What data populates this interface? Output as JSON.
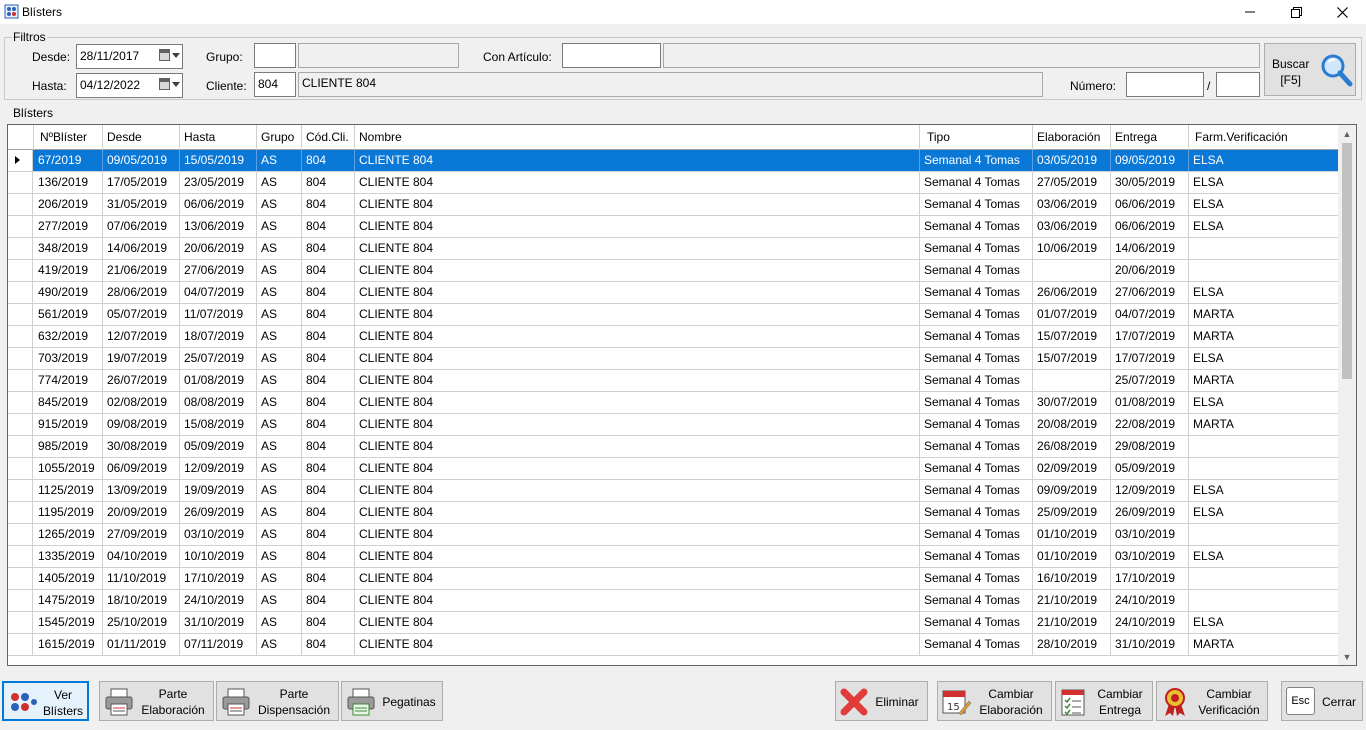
{
  "window": {
    "title": "Blísters"
  },
  "filters": {
    "group_label": "Filtros",
    "desde_label": "Desde:",
    "desde_value": "28/11/2017",
    "hasta_label": "Hasta:",
    "hasta_value": "04/12/2022",
    "grupo_label": "Grupo:",
    "grupo_code": "",
    "grupo_name": "",
    "cliente_label": "Cliente:",
    "cliente_code": "804",
    "cliente_name": "CLIENTE 804",
    "articulo_label": "Con Artículo:",
    "articulo_code": "",
    "articulo_name": "",
    "numero_label": "Número:",
    "numero_value": "",
    "numero_sep": "/",
    "numero_value2": "",
    "buscar_label_1": "Buscar",
    "buscar_label_2": "[F5]"
  },
  "grid": {
    "group_label": "Blísters",
    "columns": [
      "NºBlíster",
      "Desde",
      "Hasta",
      "Grupo",
      "Cód.Cli.",
      "Nombre",
      "Tipo",
      "Elaboración",
      "Entrega",
      "Farm.Verificación"
    ],
    "rows": [
      [
        "67/2019",
        "09/05/2019",
        "15/05/2019",
        "AS",
        "804",
        "CLIENTE 804",
        "Semanal 4 Tomas",
        "03/05/2019",
        "09/05/2019",
        "ELSA"
      ],
      [
        "136/2019",
        "17/05/2019",
        "23/05/2019",
        "AS",
        "804",
        "CLIENTE 804",
        "Semanal 4 Tomas",
        "27/05/2019",
        "30/05/2019",
        "ELSA"
      ],
      [
        "206/2019",
        "31/05/2019",
        "06/06/2019",
        "AS",
        "804",
        "CLIENTE 804",
        "Semanal 4 Tomas",
        "03/06/2019",
        "06/06/2019",
        "ELSA"
      ],
      [
        "277/2019",
        "07/06/2019",
        "13/06/2019",
        "AS",
        "804",
        "CLIENTE 804",
        "Semanal 4 Tomas",
        "03/06/2019",
        "06/06/2019",
        "ELSA"
      ],
      [
        "348/2019",
        "14/06/2019",
        "20/06/2019",
        "AS",
        "804",
        "CLIENTE 804",
        "Semanal 4 Tomas",
        "10/06/2019",
        "14/06/2019",
        ""
      ],
      [
        "419/2019",
        "21/06/2019",
        "27/06/2019",
        "AS",
        "804",
        "CLIENTE 804",
        "Semanal 4 Tomas",
        "",
        "20/06/2019",
        ""
      ],
      [
        "490/2019",
        "28/06/2019",
        "04/07/2019",
        "AS",
        "804",
        "CLIENTE 804",
        "Semanal 4 Tomas",
        "26/06/2019",
        "27/06/2019",
        "ELSA"
      ],
      [
        "561/2019",
        "05/07/2019",
        "11/07/2019",
        "AS",
        "804",
        "CLIENTE 804",
        "Semanal 4 Tomas",
        "01/07/2019",
        "04/07/2019",
        "MARTA"
      ],
      [
        "632/2019",
        "12/07/2019",
        "18/07/2019",
        "AS",
        "804",
        "CLIENTE 804",
        "Semanal 4 Tomas",
        "15/07/2019",
        "17/07/2019",
        "MARTA"
      ],
      [
        "703/2019",
        "19/07/2019",
        "25/07/2019",
        "AS",
        "804",
        "CLIENTE 804",
        "Semanal 4 Tomas",
        "15/07/2019",
        "17/07/2019",
        "ELSA"
      ],
      [
        "774/2019",
        "26/07/2019",
        "01/08/2019",
        "AS",
        "804",
        "CLIENTE 804",
        "Semanal 4 Tomas",
        "",
        "25/07/2019",
        "MARTA"
      ],
      [
        "845/2019",
        "02/08/2019",
        "08/08/2019",
        "AS",
        "804",
        "CLIENTE 804",
        "Semanal 4 Tomas",
        "30/07/2019",
        "01/08/2019",
        "ELSA"
      ],
      [
        "915/2019",
        "09/08/2019",
        "15/08/2019",
        "AS",
        "804",
        "CLIENTE 804",
        "Semanal 4 Tomas",
        "20/08/2019",
        "22/08/2019",
        "MARTA"
      ],
      [
        "985/2019",
        "30/08/2019",
        "05/09/2019",
        "AS",
        "804",
        "CLIENTE 804",
        "Semanal 4 Tomas",
        "26/08/2019",
        "29/08/2019",
        ""
      ],
      [
        "1055/2019",
        "06/09/2019",
        "12/09/2019",
        "AS",
        "804",
        "CLIENTE 804",
        "Semanal 4 Tomas",
        "02/09/2019",
        "05/09/2019",
        ""
      ],
      [
        "1125/2019",
        "13/09/2019",
        "19/09/2019",
        "AS",
        "804",
        "CLIENTE 804",
        "Semanal 4 Tomas",
        "09/09/2019",
        "12/09/2019",
        "ELSA"
      ],
      [
        "1195/2019",
        "20/09/2019",
        "26/09/2019",
        "AS",
        "804",
        "CLIENTE 804",
        "Semanal 4 Tomas",
        "25/09/2019",
        "26/09/2019",
        "ELSA"
      ],
      [
        "1265/2019",
        "27/09/2019",
        "03/10/2019",
        "AS",
        "804",
        "CLIENTE 804",
        "Semanal 4 Tomas",
        "01/10/2019",
        "03/10/2019",
        ""
      ],
      [
        "1335/2019",
        "04/10/2019",
        "10/10/2019",
        "AS",
        "804",
        "CLIENTE 804",
        "Semanal 4 Tomas",
        "01/10/2019",
        "03/10/2019",
        "ELSA"
      ],
      [
        "1405/2019",
        "11/10/2019",
        "17/10/2019",
        "AS",
        "804",
        "CLIENTE 804",
        "Semanal 4 Tomas",
        "16/10/2019",
        "17/10/2019",
        ""
      ],
      [
        "1475/2019",
        "18/10/2019",
        "24/10/2019",
        "AS",
        "804",
        "CLIENTE 804",
        "Semanal 4 Tomas",
        "21/10/2019",
        "24/10/2019",
        ""
      ],
      [
        "1545/2019",
        "25/10/2019",
        "31/10/2019",
        "AS",
        "804",
        "CLIENTE 804",
        "Semanal 4 Tomas",
        "21/10/2019",
        "24/10/2019",
        "ELSA"
      ],
      [
        "1615/2019",
        "01/11/2019",
        "07/11/2019",
        "AS",
        "804",
        "CLIENTE 804",
        "Semanal 4 Tomas",
        "28/10/2019",
        "31/10/2019",
        "MARTA"
      ]
    ],
    "selected_row": 0
  },
  "buttons": {
    "ver_blisters": [
      "Ver",
      "Blísters"
    ],
    "parte_elaboracion": [
      "Parte",
      "Elaboración"
    ],
    "parte_dispensacion": [
      "Parte",
      "Dispensación"
    ],
    "pegatinas": "Pegatinas",
    "eliminar": "Eliminar",
    "cambiar_elaboracion": [
      "Cambiar",
      "Elaboración"
    ],
    "cambiar_entrega": [
      "Cambiar",
      "Entrega"
    ],
    "cambiar_verificacion": [
      "Cambiar",
      "Verificación"
    ],
    "cerrar": "Cerrar",
    "esc_key": "Esc"
  },
  "icons": {
    "app": "blister-app-icon",
    "buscar": "magnifier-icon",
    "ver": "pills-icon",
    "parte": "printer-icon",
    "pegatinas": "label-printer-icon",
    "eliminar": "red-x-icon",
    "cambiar_elaboracion": "calendar-pen-icon",
    "cambiar_entrega": "checklist-icon",
    "cambiar_verificacion": "award-ribbon-icon",
    "cerrar": "esc-key-icon"
  },
  "colors": {
    "selection": "#0a78d7",
    "active_button": "#0078d7",
    "delete_red": "#e03c3c"
  }
}
